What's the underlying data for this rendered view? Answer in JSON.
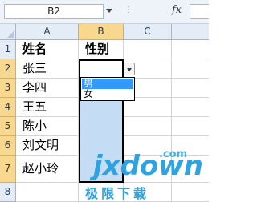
{
  "formula_bar": {
    "name_box": "B2",
    "fx_label": "fx",
    "formula": ""
  },
  "columns": [
    "A",
    "B",
    "C"
  ],
  "rows": [
    "1",
    "2",
    "3",
    "4",
    "5",
    "6",
    "7",
    "8"
  ],
  "cells": {
    "A1": "姓名",
    "B1": "性别",
    "A2": "张三",
    "A3": "李四",
    "A4": "王五",
    "A5": "陈小",
    "A6": "刘文明",
    "A7": "赵小玲"
  },
  "dropdown": {
    "options": [
      "男",
      "女"
    ],
    "highlighted": "男"
  },
  "watermark": {
    "brand": "jxdown",
    "domain": ".com",
    "chinese": "极限下载"
  },
  "colors": {
    "selection": "#c5dcf5",
    "header_selected": "#f8d88e",
    "option_highlight": "#3399ff",
    "watermark": "#2fa3df"
  }
}
